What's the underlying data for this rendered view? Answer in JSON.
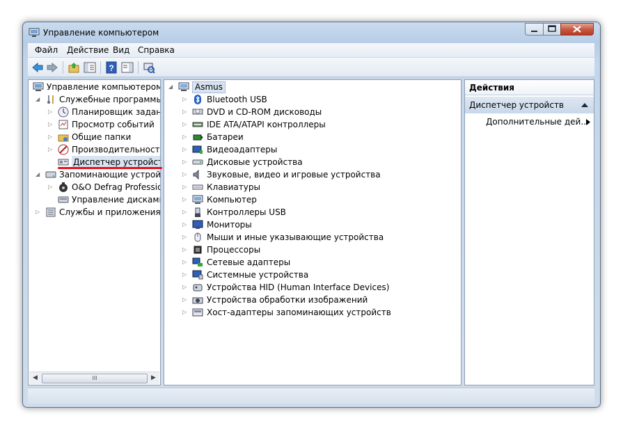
{
  "window": {
    "title": "Управление компьютером"
  },
  "menu": [
    "Файл",
    "Действие",
    "Вид",
    "Справка"
  ],
  "toolbar_icons": [
    "back-arrow-icon",
    "forward-arrow-icon",
    "up-folder-icon",
    "show-hide-tree-icon",
    "help-icon",
    "show-hide-action-pane-icon",
    "scan-hardware-icon"
  ],
  "left_tree": [
    {
      "label": "Управление компьютером (л",
      "level": 0,
      "expander": "",
      "icon": "computer-management-icon"
    },
    {
      "label": "Служебные программы",
      "level": 1,
      "expander": "open",
      "icon": "tools-icon"
    },
    {
      "label": "Планировщик заданий",
      "level": 2,
      "expander": "closed",
      "icon": "clock-icon"
    },
    {
      "label": "Просмотр событий",
      "level": 2,
      "expander": "closed",
      "icon": "event-viewer-icon"
    },
    {
      "label": "Общие папки",
      "level": 2,
      "expander": "closed",
      "icon": "shared-folders-icon"
    },
    {
      "label": "Производительность",
      "level": 2,
      "expander": "closed",
      "icon": "performance-icon"
    },
    {
      "label": "Диспетчер устройств",
      "level": 2,
      "expander": "",
      "icon": "device-manager-icon",
      "selected": true
    },
    {
      "label": "Запоминающие устройст",
      "level": 1,
      "expander": "open",
      "icon": "storage-icon"
    },
    {
      "label": "O&O Defrag Profession",
      "level": 2,
      "expander": "closed",
      "icon": "defrag-icon"
    },
    {
      "label": "Управление дисками",
      "level": 2,
      "expander": "",
      "icon": "disk-management-icon"
    },
    {
      "label": "Службы и приложения",
      "level": 1,
      "expander": "closed",
      "icon": "services-icon"
    }
  ],
  "device_root": "Asmus",
  "devices": [
    {
      "label": "Bluetooth USB",
      "icon": "bluetooth-icon"
    },
    {
      "label": "DVD и CD-ROM дисководы",
      "icon": "dvd-drive-icon"
    },
    {
      "label": "IDE ATA/ATAPI контроллеры",
      "icon": "ide-controller-icon"
    },
    {
      "label": "Батареи",
      "icon": "battery-icon"
    },
    {
      "label": "Видеоадаптеры",
      "icon": "display-adapter-icon"
    },
    {
      "label": "Дисковые устройства",
      "icon": "disk-drive-icon"
    },
    {
      "label": "Звуковые, видео и игровые устройства",
      "icon": "sound-icon"
    },
    {
      "label": "Клавиатуры",
      "icon": "keyboard-icon"
    },
    {
      "label": "Компьютер",
      "icon": "computer-icon"
    },
    {
      "label": "Контроллеры USB",
      "icon": "usb-icon"
    },
    {
      "label": "Мониторы",
      "icon": "monitor-icon"
    },
    {
      "label": "Мыши и иные указывающие устройства",
      "icon": "mouse-icon"
    },
    {
      "label": "Процессоры",
      "icon": "processor-icon"
    },
    {
      "label": "Сетевые адаптеры",
      "icon": "network-adapter-icon"
    },
    {
      "label": "Системные устройства",
      "icon": "system-devices-icon"
    },
    {
      "label": "Устройства HID (Human Interface Devices)",
      "icon": "hid-icon"
    },
    {
      "label": "Устройства обработки изображений",
      "icon": "imaging-icon"
    },
    {
      "label": "Хост-адаптеры запоминающих устройств",
      "icon": "storage-controller-icon"
    }
  ],
  "actions": {
    "header": "Действия",
    "section": "Диспетчер устройств",
    "item": "Дополнительные дей..."
  },
  "scrollbar_grip": "III",
  "colors": {
    "accent_underline": "#e3101a",
    "selection": "#d9e4f2"
  }
}
